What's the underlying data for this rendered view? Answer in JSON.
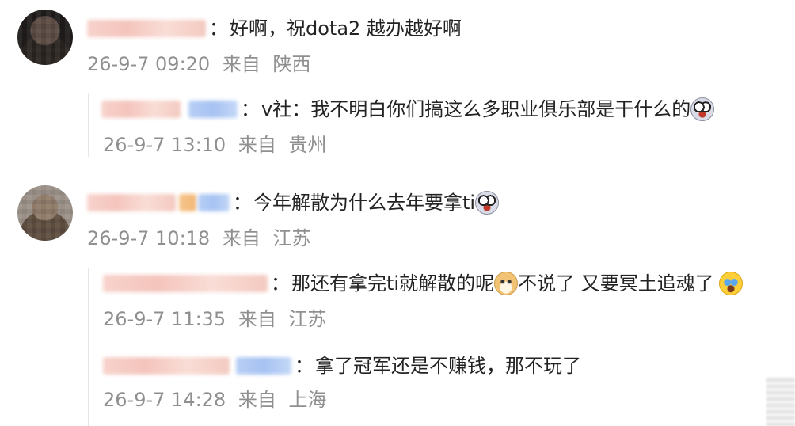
{
  "comments": [
    {
      "text": "好啊，祝dota2 越办越好啊",
      "date": "26-9-7 09:20",
      "location_prefix": "来自",
      "location": "陕西",
      "avatar_icon": "user-avatar-icon",
      "replies": [
        {
          "text": "v社：我不明白你们搞这么多职业俱乐部是干什么的",
          "emoji": "shocked-face-emoji",
          "date": "26-9-7 13:10",
          "location_prefix": "来自",
          "location": "贵州"
        }
      ]
    },
    {
      "text": "今年解散为什么去年要拿ti",
      "emoji": "shocked-face-emoji",
      "date": "26-9-7 10:18",
      "location_prefix": "来自",
      "location": "江苏",
      "avatar_icon": "user-avatar-icon",
      "replies": [
        {
          "text_a": "那还有拿完ti就解散的呢",
          "emoji_a": "doge-emoji",
          "text_b": "不说了 又要冥土追魂了",
          "emoji_b": "crying-face-emoji",
          "date": "26-9-7 11:35",
          "location_prefix": "来自",
          "location": "江苏"
        },
        {
          "text": "拿了冠军还是不赚钱，那不玩了",
          "date": "26-9-7 14:28",
          "location_prefix": "来自",
          "location": "上海"
        }
      ]
    }
  ],
  "separator": "："
}
